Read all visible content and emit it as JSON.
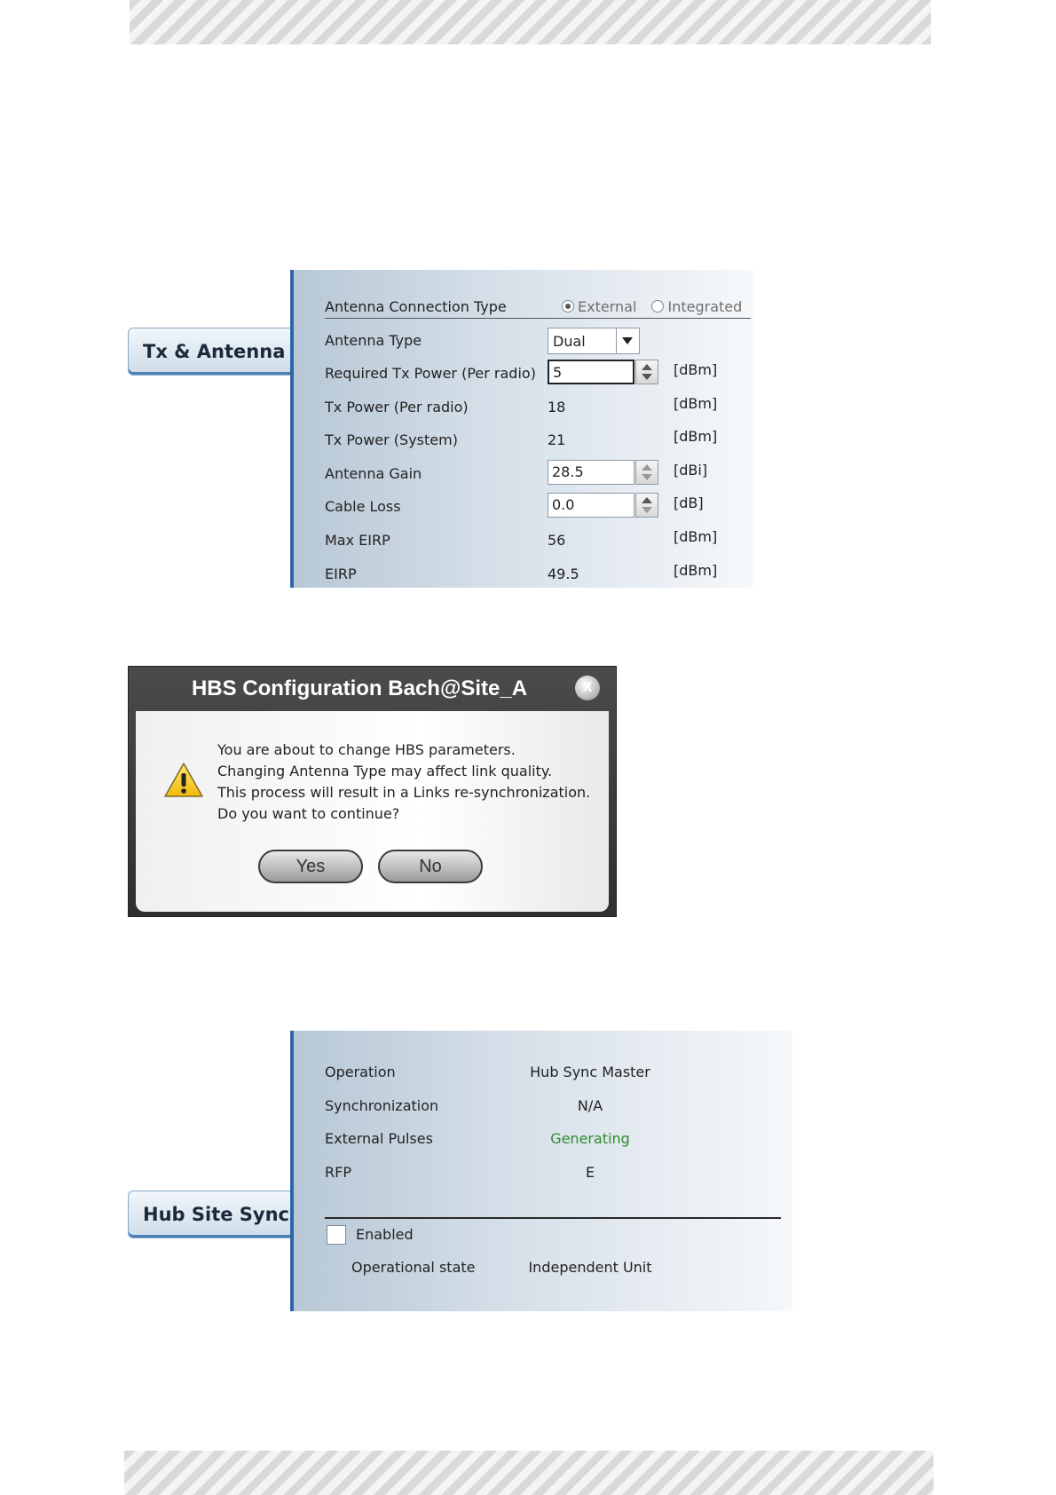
{
  "tx_antenna": {
    "tab_label": "Tx & Antenna",
    "connection_type": {
      "label": "Antenna Connection Type",
      "options": [
        "External",
        "Integrated"
      ],
      "selected": "External"
    },
    "antenna_type": {
      "label": "Antenna Type",
      "value": "Dual"
    },
    "required_tx_power": {
      "label": "Required Tx Power (Per radio)",
      "value": "5",
      "unit": "[dBm]"
    },
    "tx_power_radio": {
      "label": "Tx Power (Per radio)",
      "value": "18",
      "unit": "[dBm]"
    },
    "tx_power_system": {
      "label": "Tx Power (System)",
      "value": "21",
      "unit": "[dBm]"
    },
    "antenna_gain": {
      "label": "Antenna Gain",
      "value": "28.5",
      "unit": "[dBi]"
    },
    "cable_loss": {
      "label": "Cable Loss",
      "value": "0.0",
      "unit": "[dB]"
    },
    "max_eirp": {
      "label": "Max EIRP",
      "value": "56",
      "unit": "[dBm]"
    },
    "eirp": {
      "label": "EIRP",
      "value": "49.5",
      "unit": "[dBm]"
    }
  },
  "dialog": {
    "title": "HBS Configuration Bach@Site_A",
    "close": "X",
    "lines": [
      "You are about to change HBS parameters.",
      "Changing Antenna Type may affect link quality.",
      "This process will result in a Links re-synchronization.",
      "Do you want to continue?"
    ],
    "yes_label": "Yes",
    "no_label": "No"
  },
  "hub_site_sync": {
    "tab_label": "Hub Site Sync",
    "operation": {
      "label": "Operation",
      "value": "Hub Sync Master"
    },
    "synchronization": {
      "label": "Synchronization",
      "value": "N/A"
    },
    "external_pulses": {
      "label": "External Pulses",
      "value": "Generating",
      "color": "#2e8b2e"
    },
    "rfp": {
      "label": "RFP",
      "value": "E"
    },
    "enabled": {
      "label": "Enabled",
      "checked": false
    },
    "operational_state": {
      "label": "Operational state",
      "value": "Independent Unit"
    }
  }
}
